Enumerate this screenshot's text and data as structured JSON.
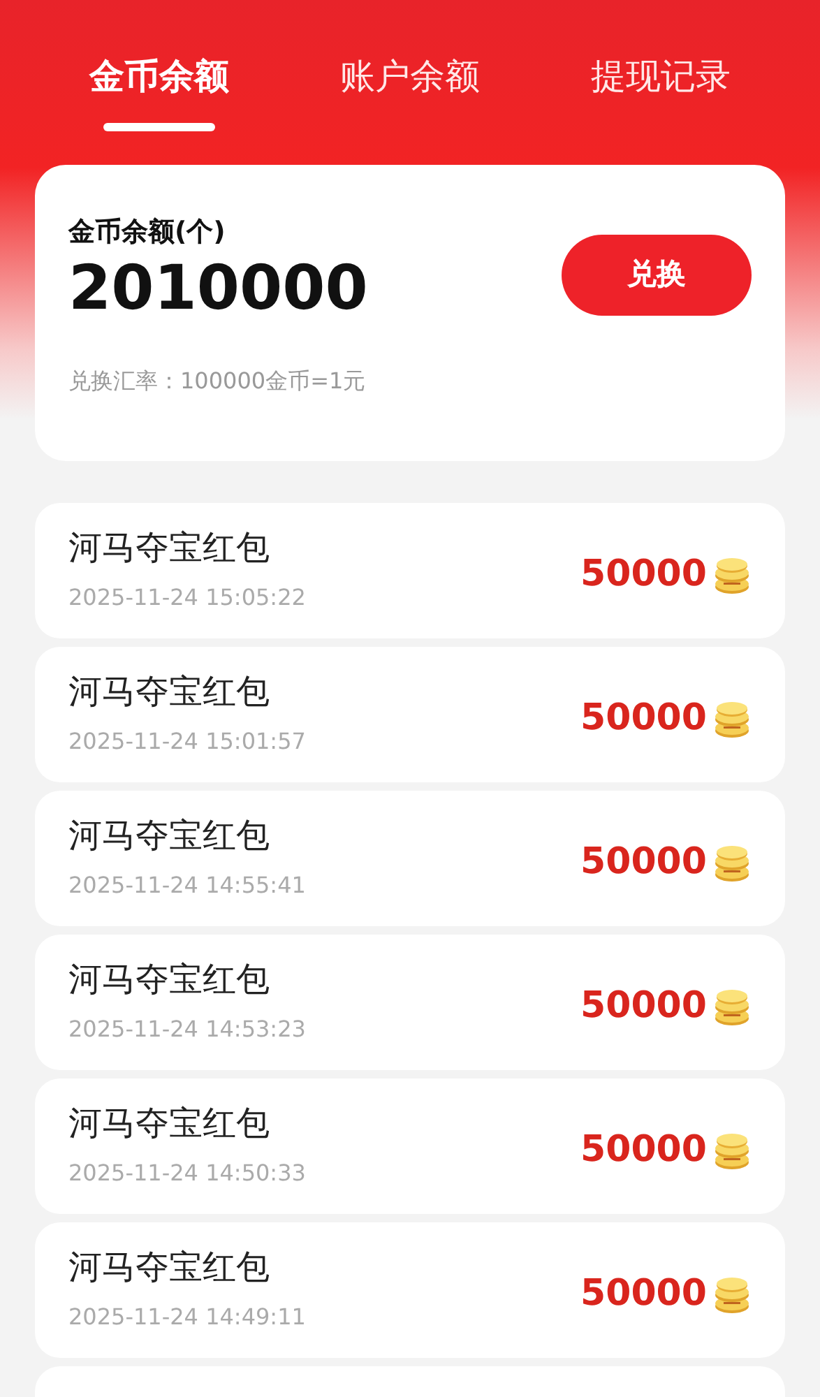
{
  "tabs": [
    {
      "label": "金币余额",
      "selected": true
    },
    {
      "label": "账户余额",
      "selected": false
    },
    {
      "label": "提现记录",
      "selected": false
    }
  ],
  "balance": {
    "label": "金币余额(个)",
    "value": "2010000",
    "button": "兑换",
    "rate": "兑换汇率：100000金币=1元"
  },
  "records": [
    {
      "title": "河马夺宝红包",
      "time": "2025-11-24 15:05:22",
      "amount": "50000"
    },
    {
      "title": "河马夺宝红包",
      "time": "2025-11-24 15:01:57",
      "amount": "50000"
    },
    {
      "title": "河马夺宝红包",
      "time": "2025-11-24 14:55:41",
      "amount": "50000"
    },
    {
      "title": "河马夺宝红包",
      "time": "2025-11-24 14:53:23",
      "amount": "50000"
    },
    {
      "title": "河马夺宝红包",
      "time": "2025-11-24 14:50:33",
      "amount": "50000"
    },
    {
      "title": "河马夺宝红包",
      "time": "2025-11-24 14:49:11",
      "amount": "50000"
    }
  ]
}
